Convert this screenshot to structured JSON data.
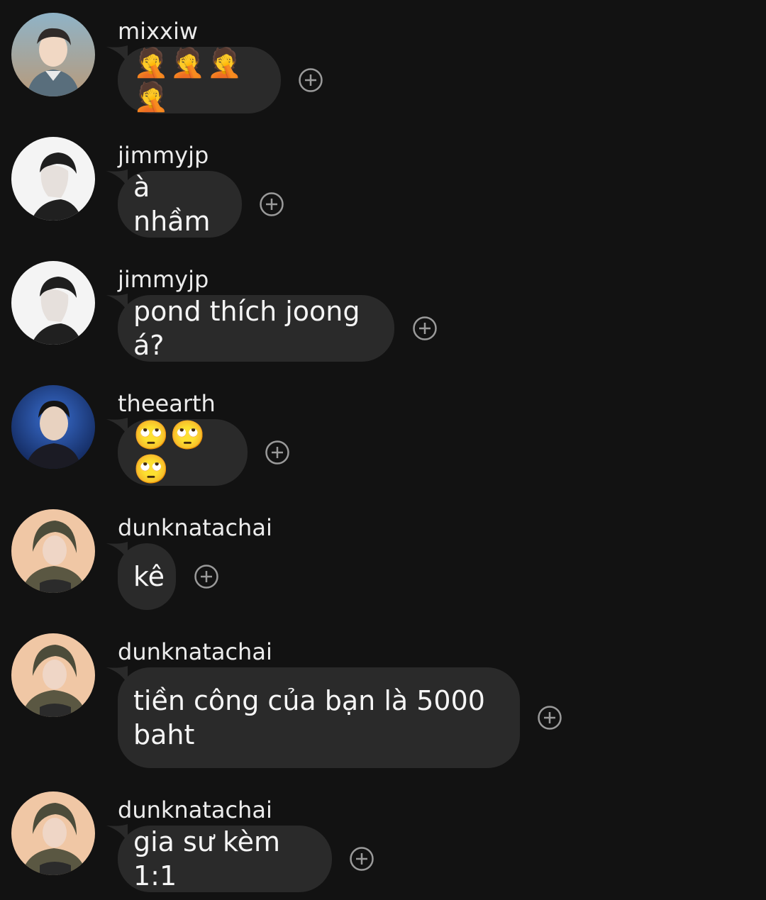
{
  "messages": [
    {
      "username": "mixxiw",
      "text": "🤦🤦🤦🤦",
      "avatar": "avatar-mixxiw"
    },
    {
      "username": "jimmyjp",
      "text": "à nhầm",
      "avatar": "avatar-jimmyjp"
    },
    {
      "username": "jimmyjp",
      "text": "pond thích joong á?",
      "avatar": "avatar-jimmyjp"
    },
    {
      "username": "theearth",
      "text": "🙄🙄🙄",
      "avatar": "avatar-theearth"
    },
    {
      "username": "dunknatachai",
      "text": "kê",
      "avatar": "avatar-dunknatachai"
    },
    {
      "username": "dunknatachai",
      "text": "tiền công của bạn là 5000\nbaht",
      "avatar": "avatar-dunknatachai"
    },
    {
      "username": "dunknatachai",
      "text": "gia sư kèm 1:1",
      "avatar": "avatar-dunknatachai"
    }
  ],
  "icons": {
    "react": "add-reaction-icon"
  },
  "colors": {
    "background": "#121212",
    "bubble": "#2a2a2a",
    "text": "#f5f5f5",
    "react_icon": "#9a9a9a"
  }
}
